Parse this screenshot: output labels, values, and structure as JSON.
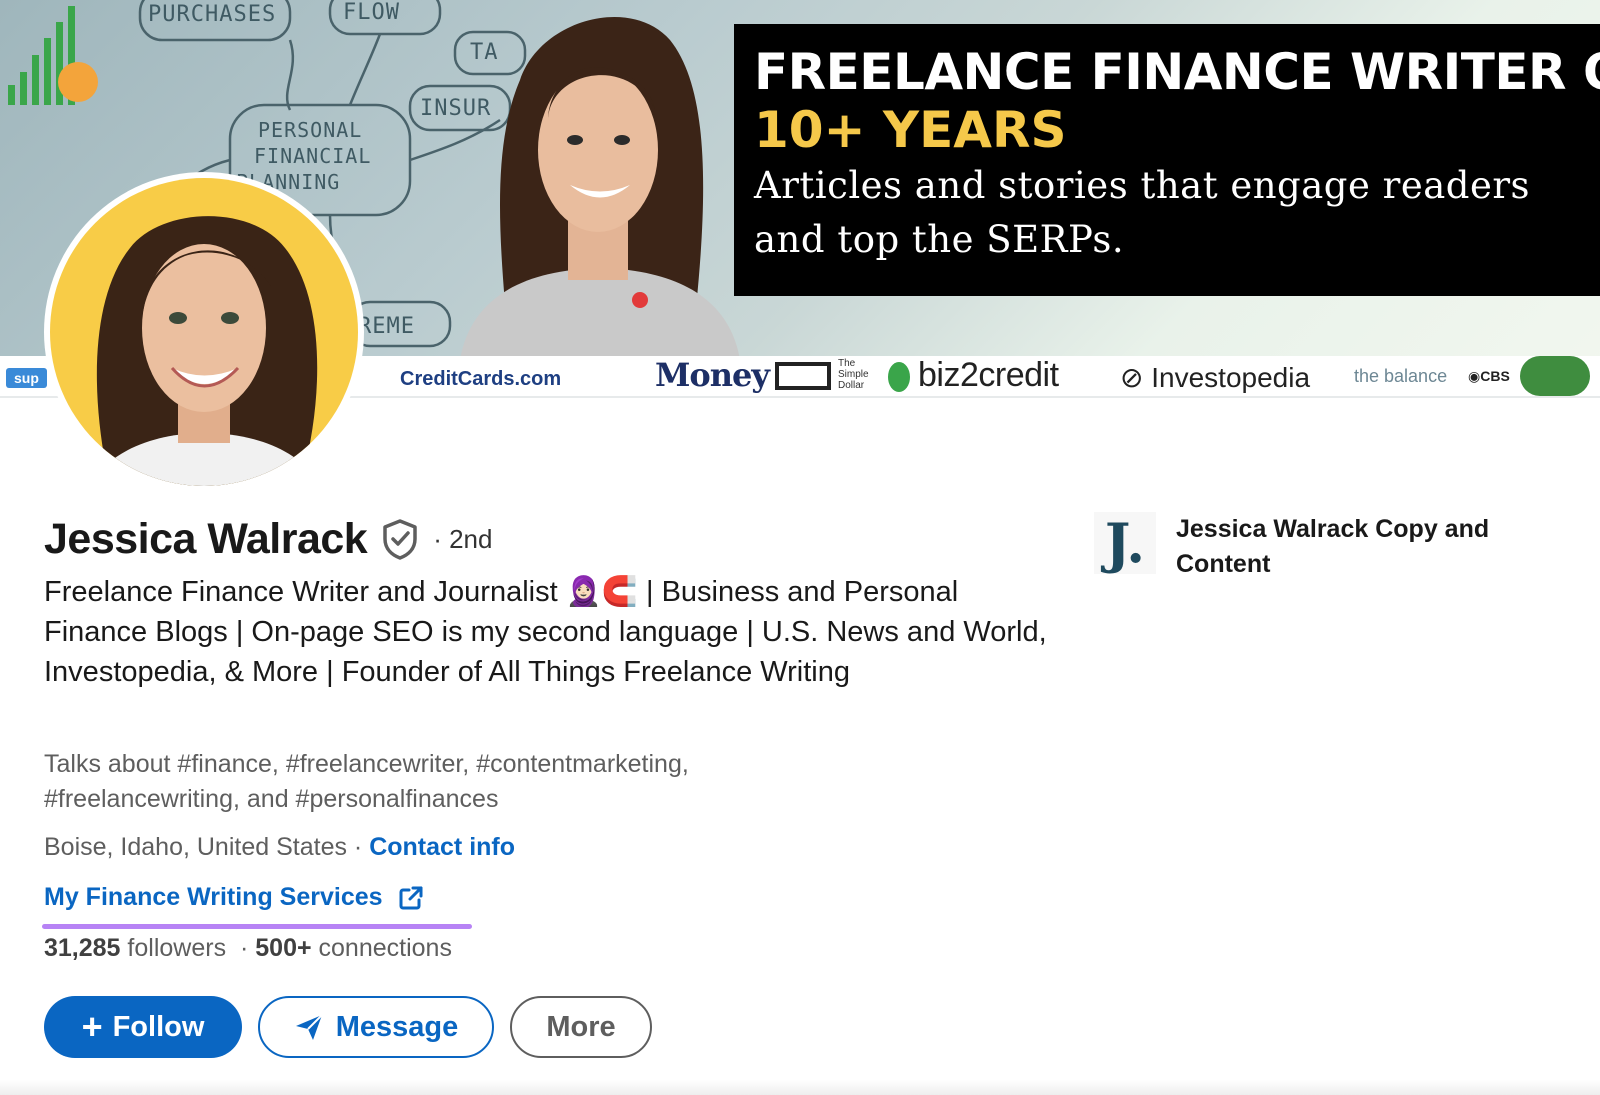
{
  "banner": {
    "headline": "FREELANCE FINANCE WRITER OF",
    "years": "10+ YEARS",
    "tagline_1": "Articles and stories that engage readers",
    "tagline_2": "and top the SERPs.",
    "sketch_words": [
      "PURCHASES",
      "FLOW",
      "TA",
      "INSUR",
      "PERSONAL",
      "FINANCIAL",
      "PLANNING",
      "REME"
    ],
    "logos": {
      "sup": "sup",
      "creditcards": "CreditCards.com",
      "money": "Money",
      "simple_dollar": [
        "The",
        "Simple",
        "Dollar"
      ],
      "biz2credit": "biz2credit",
      "investopedia": "Investopedia",
      "the_balance": "the balance",
      "cbs": "CBS"
    },
    "colors": {
      "accent_yellow": "#f5c84a",
      "box": "#000000"
    }
  },
  "profile": {
    "name": "Jessica Walrack",
    "degree": "· 2nd",
    "headline": "Freelance Finance Writer and Journalist 🧕🏻🧲 | Business and Personal Finance Blogs | On-page SEO is my second language | U.S. News and World, Investopedia, & More | Founder of All Things Freelance Writing",
    "talks_about": "Talks about #finance, #freelancewriter, #contentmarketing, #freelancewriting, and #personalfinances",
    "location": "Boise, Idaho, United States ·",
    "contact_info": "Contact info",
    "service_link": "My Finance Writing Services",
    "followers_count": "31,285",
    "followers_label": "followers",
    "connections_count": "500+",
    "connections_label": "connections",
    "separator": "·"
  },
  "actions": {
    "follow": "Follow",
    "follow_plus": "+",
    "message": "Message",
    "more": "More"
  },
  "company": {
    "logo_letter": "J.",
    "name": "Jessica Walrack Copy and Content"
  },
  "icons": [
    "verified-shield-icon",
    "external-link-icon",
    "send-icon",
    "plus-icon"
  ],
  "colors": {
    "link": "#0a66c2",
    "highlight_underline": "#b783f5",
    "avatar_bg": "#f8cc47"
  }
}
